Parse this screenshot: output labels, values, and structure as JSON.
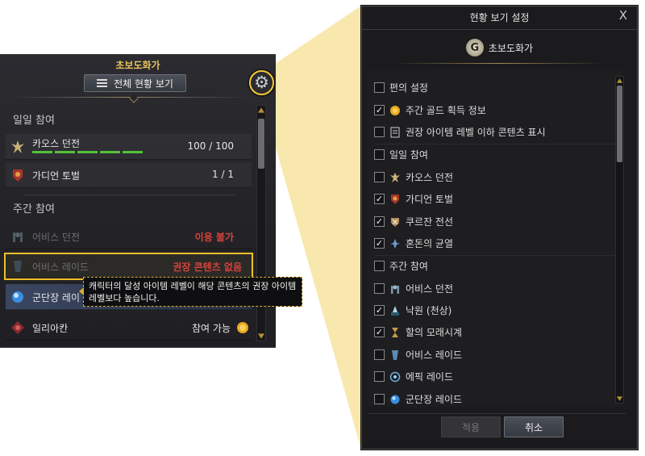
{
  "left_panel": {
    "title": "초보도화가",
    "view_all_button": "전체 현황 보기",
    "sections": {
      "daily": "일일 참여",
      "weekly": "주간 참여"
    },
    "rows": [
      {
        "name": "카오스 던전",
        "value": "100 / 100",
        "progress_segments": 5
      },
      {
        "name": "가디언 토벌",
        "value": "1  /  1",
        "progress_segments": 0
      },
      {
        "name": "어비스 던전",
        "value": "이용 불가",
        "status": "disabled"
      },
      {
        "name": "어비스 레이드",
        "value": "권장 콘텐츠 없음",
        "status": "disabled"
      },
      {
        "name": "군단장 레이",
        "value": "",
        "status": "selected"
      },
      {
        "name": "일리아칸",
        "value": "참여 가능"
      }
    ],
    "tooltip": {
      "line1": "캐릭터의 달성 아이템 레벨이 해당 콘텐츠의 권장 아이템",
      "line2": "레벨보다 높습니다."
    }
  },
  "dialog": {
    "title": "현황 보기 설정",
    "close_label": "X",
    "character_name": "초보도화가",
    "options": [
      {
        "label": "편의 설정",
        "checked": false,
        "type": "header"
      },
      {
        "label": "주간 골드 획득 정보",
        "checked": true,
        "icon": "gold-coin-icon"
      },
      {
        "label": "권장 아이템 레벨 이하 콘텐츠 표시",
        "checked": false,
        "icon": "list-icon"
      },
      {
        "label": "일일 참여",
        "checked": false,
        "type": "header"
      },
      {
        "label": "카오스 던전",
        "checked": false,
        "icon": "chaos-dungeon-icon"
      },
      {
        "label": "가디언 토벌",
        "checked": true,
        "icon": "guardian-raid-icon"
      },
      {
        "label": "쿠르잔 전선",
        "checked": true,
        "icon": "kurzan-front-icon"
      },
      {
        "label": "혼돈의 균열",
        "checked": true,
        "icon": "chaos-rift-icon"
      },
      {
        "label": "주간 참여",
        "checked": false,
        "type": "header"
      },
      {
        "label": "어비스 던전",
        "checked": false,
        "icon": "abyss-dungeon-icon"
      },
      {
        "label": "낙원 (천상)",
        "checked": true,
        "icon": "paradise-icon"
      },
      {
        "label": "할의 모래시계",
        "checked": true,
        "icon": "hourglass-icon"
      },
      {
        "label": "어비스 레이드",
        "checked": false,
        "icon": "abyss-raid-icon"
      },
      {
        "label": "에픽 레이드",
        "checked": false,
        "icon": "epic-raid-icon"
      },
      {
        "label": "군단장 레이드",
        "checked": false,
        "icon": "legion-raid-icon"
      }
    ],
    "apply_button": "적용",
    "cancel_button": "취소"
  },
  "colors": {
    "accent_gold": "#f0c02a",
    "warn_red": "#d4443c",
    "progress_green": "#52c23a"
  }
}
